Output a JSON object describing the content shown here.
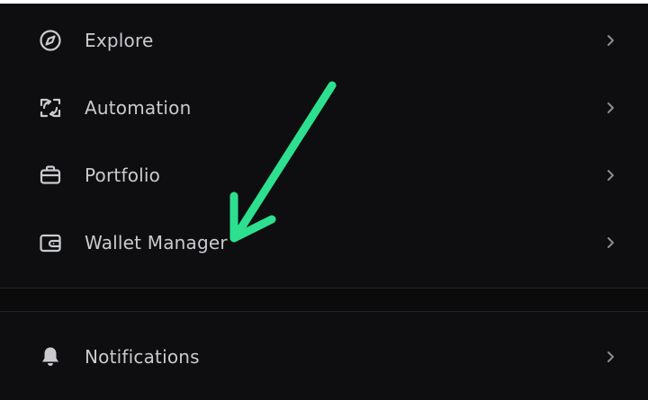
{
  "menu": {
    "items": [
      {
        "label": "Explore",
        "icon": "compass-icon"
      },
      {
        "label": "Automation",
        "icon": "automation-icon"
      },
      {
        "label": "Portfolio",
        "icon": "briefcase-icon"
      },
      {
        "label": "Wallet Manager",
        "icon": "wallet-icon"
      }
    ]
  },
  "secondary_menu": {
    "items": [
      {
        "label": "Notifications",
        "icon": "bell-icon"
      }
    ]
  },
  "annotation": {
    "color": "#2de08f",
    "points_to": "Wallet Manager"
  },
  "colors": {
    "background": "#0e0e10",
    "text": "#c9cbcf",
    "icon": "#c9cbcf",
    "chevron": "#8a8d93"
  }
}
